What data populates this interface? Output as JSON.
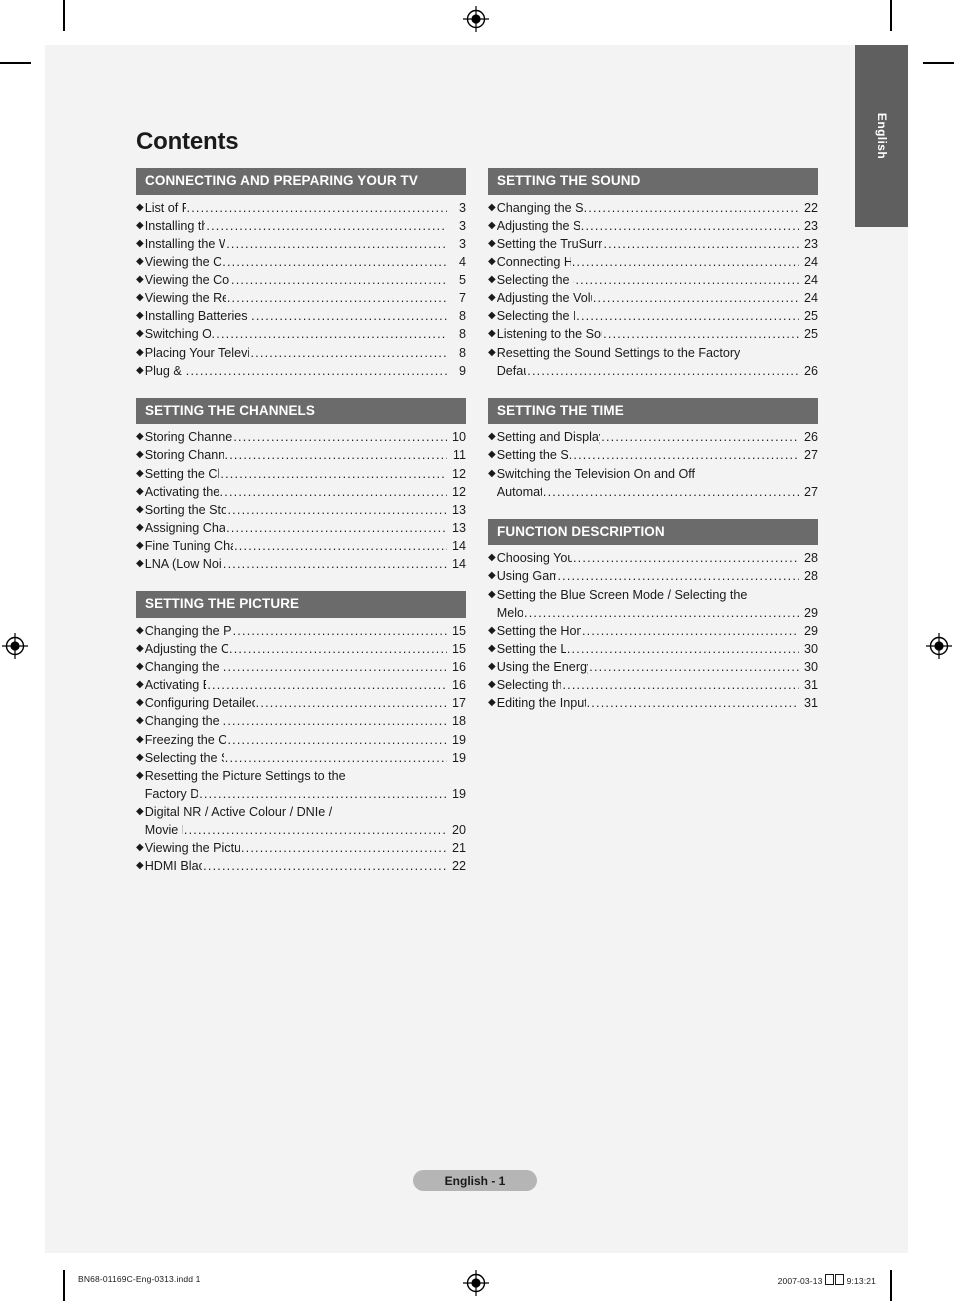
{
  "page": {
    "title": "Contents",
    "badge": "English - 1",
    "side_tab": "English",
    "accent_header_bg": "#6b6b6b",
    "sheet_bg": "#f3f3f3",
    "tab_bg": "#5f5f5f",
    "badge_bg": "#b5b5b5"
  },
  "print_footer": {
    "filename": "BN68-01169C-Eng-0313.indd   1",
    "date": "2007-03-13",
    "time": "9:13:21"
  },
  "left_column": [
    {
      "header": "CONNECTING AND PREPARING YOUR TV",
      "items": [
        {
          "label": "List of Parts",
          "page": "3"
        },
        {
          "label": "Installing the Stand",
          "page": "3"
        },
        {
          "label": "Installing the Wall Mount Kit",
          "page": "3"
        },
        {
          "label": "Viewing the Control Panel",
          "page": "4"
        },
        {
          "label": "Viewing the Connection Panel",
          "page": "5"
        },
        {
          "label": "Viewing the Remote Control",
          "page": "7"
        },
        {
          "label": "Installing Batteries in the Remote Control",
          "page": "8"
        },
        {
          "label": "Switching On and Off",
          "page": "8"
        },
        {
          "label": "Placing Your Television in Standby Mode",
          "page": "8"
        },
        {
          "label": "Plug & Play",
          "page": "9"
        }
      ]
    },
    {
      "header": "SETTING THE CHANNELS",
      "items": [
        {
          "label": "Storing Channels Automatically",
          "page": "10"
        },
        {
          "label": "Storing Channels Manually",
          "page": "11"
        },
        {
          "label": "Setting the Channel Lists",
          "page": "12"
        },
        {
          "label": "Activating the Child Lock",
          "page": "12"
        },
        {
          "label": "Sorting the Stored Channels",
          "page": "13"
        },
        {
          "label": "Assigning Channels Names",
          "page": "13"
        },
        {
          "label": "Fine Tuning Channel Reception",
          "page": "14"
        },
        {
          "label": "LNA (Low Noise Amplifier)",
          "page": "14"
        }
      ]
    },
    {
      "header": "SETTING THE PICTURE",
      "items": [
        {
          "label": "Changing the Picture Standard",
          "page": "15"
        },
        {
          "label": "Adjusting the Custom Picture",
          "page": "15"
        },
        {
          "label": "Changing the Colour Tone",
          "page": "16"
        },
        {
          "label": "Activating Backlight",
          "page": "16"
        },
        {
          "label": "Configuring Detailed Settings on the Picture",
          "page": "17"
        },
        {
          "label": "Changing the Picture Size",
          "page": "18"
        },
        {
          "label": "Freezing the Current Picture",
          "page": "19"
        },
        {
          "label": "Selecting the Screen Mode",
          "page": "19"
        },
        {
          "label": "Resetting the Picture Settings to the",
          "label2": "Factory Defaults",
          "page": "19"
        },
        {
          "label": "Digital NR / Active Colour / DNIe /",
          "label2": "Movie Plus",
          "page": "20"
        },
        {
          "label": "Viewing the Picture In Picture (PIP)",
          "page": "21"
        },
        {
          "label": "HDMI Black Level",
          "page": "22"
        }
      ]
    }
  ],
  "right_column": [
    {
      "header": "SETTING THE SOUND",
      "items": [
        {
          "label": "Changing the Sound Standard",
          "page": "22"
        },
        {
          "label": "Adjusting the Sound Settings",
          "page": "23"
        },
        {
          "label": "Setting the TruSurround XT (SRS TS XT)",
          "page": "23"
        },
        {
          "label": "Connecting Headphones",
          "page": "24"
        },
        {
          "label": "Selecting the Sound Mode",
          "page": "24"
        },
        {
          "label": "Adjusting the Volume Automatically",
          "page": "24"
        },
        {
          "label": "Selecting the Internal Mute",
          "page": "25"
        },
        {
          "label": "Listening to the Sound of the Sub Picture",
          "page": "25"
        },
        {
          "label": "Resetting the Sound Settings to the Factory",
          "label2": "Defaults",
          "page": "26"
        }
      ]
    },
    {
      "header": "SETTING THE TIME",
      "items": [
        {
          "label": "Setting and Displaying the Current Time",
          "page": "26"
        },
        {
          "label": "Setting the Sleep Timer",
          "page": "27"
        },
        {
          "label": "Switching the Television On and Off",
          "label2": "Automatically",
          "page": "27"
        }
      ]
    },
    {
      "header": "FUNCTION DESCRIPTION",
      "items": [
        {
          "label": "Choosing Your Language",
          "page": "28"
        },
        {
          "label": "Using Game Mode",
          "page": "28"
        },
        {
          "label": "Setting the Blue Screen Mode / Selecting the",
          "label2": "Melody",
          "page": "29"
        },
        {
          "label": "Setting the Home Theater PC",
          "page": "29"
        },
        {
          "label": "Setting the Light Effect",
          "page": "30"
        },
        {
          "label": "Using the Energy Saving Feature",
          "page": "30"
        },
        {
          "label": "Selecting the Source",
          "page": "31"
        },
        {
          "label": "Editing the Input Source Names",
          "page": "31"
        }
      ]
    }
  ]
}
